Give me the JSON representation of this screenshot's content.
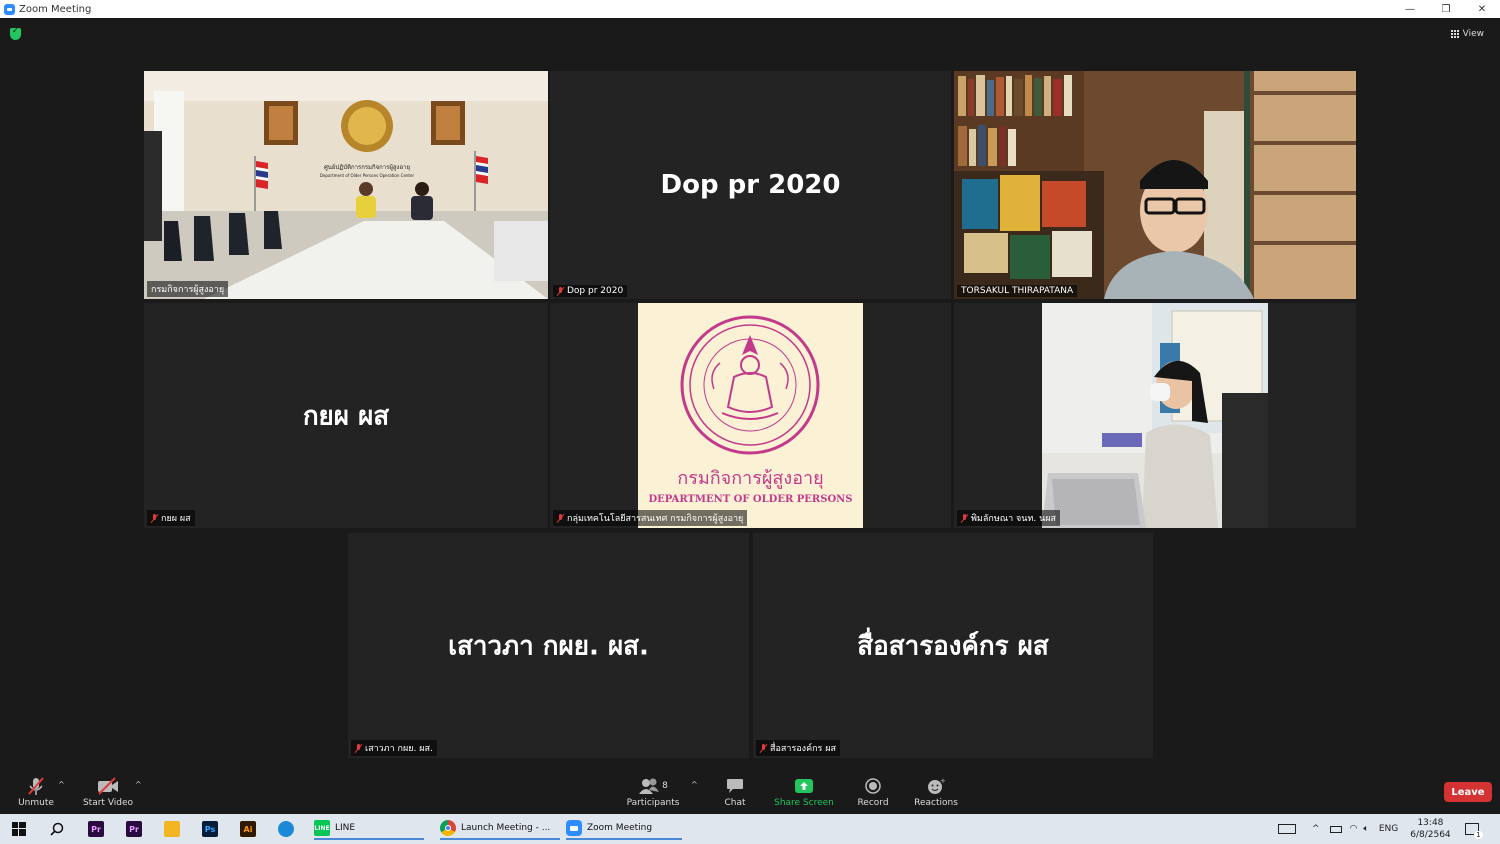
{
  "window": {
    "title": "Zoom Meeting",
    "minimize": "—",
    "restore": "❐",
    "close": "✕"
  },
  "top": {
    "view_label": "View"
  },
  "tiles": [
    {
      "id": "t1",
      "name": "กรมกิจการผู้สูงอายุ",
      "type": "video",
      "active": true
    },
    {
      "id": "t2",
      "name": "Dop pr 2020",
      "big": "Dop pr 2020",
      "type": "name"
    },
    {
      "id": "t3",
      "name": "TORSAKUL THIRAPATANA",
      "type": "video"
    },
    {
      "id": "t4",
      "name": "กยผ ผส",
      "big": "กยผ ผส",
      "type": "name"
    },
    {
      "id": "t5",
      "name": "กลุ่มเทคโนโลยีสารสนเทศ กรมกิจการผู้สูงอายุ",
      "type": "logo",
      "logo_text_th": "กรมกิจการผู้สูงอายุ",
      "logo_text_en": "DEPARTMENT OF OLDER PERSONS"
    },
    {
      "id": "t6",
      "name": "พิมลักษณา จนท. นผส",
      "type": "video"
    },
    {
      "id": "t7",
      "name": "เสาวภา กผย. ผส.",
      "big": "เสาวภา กผย. ผส.",
      "type": "name"
    },
    {
      "id": "t8",
      "name": "สื่อสารองค์กร ผส",
      "big": "สื่อสารองค์กร ผส",
      "type": "name"
    }
  ],
  "room_sign": {
    "line1": "ศูนย์ปฏิบัติการกรมกิจการผู้สูงอายุ",
    "line2": "Department of Older Persons Operation Center"
  },
  "toolbar": {
    "unmute": "Unmute",
    "start_video": "Start Video",
    "participants": "Participants",
    "participants_count": "8",
    "chat": "Chat",
    "share_screen": "Share Screen",
    "record": "Record",
    "reactions": "Reactions",
    "leave": "Leave"
  },
  "taskbar": {
    "apps": [
      {
        "name": "Pr",
        "color": "#2a0b3f",
        "fg": "#e49bff"
      },
      {
        "name": "Pr",
        "color": "#2a0b3f",
        "fg": "#e49bff"
      },
      {
        "name": "",
        "color": "#f2b624",
        "fg": "#fff"
      },
      {
        "name": "Ps",
        "color": "#061e3a",
        "fg": "#31a8ff"
      },
      {
        "name": "Ai",
        "color": "#2f1a00",
        "fg": "#ff9a00"
      }
    ],
    "line_label": "LINE",
    "chrome_label": "Launch Meeting - ...",
    "zoom_label": "Zoom Meeting",
    "lang": "ENG",
    "time": "13:48",
    "date": "6/8/2564",
    "notif_count": "1"
  },
  "colors": {
    "accent": "#2d8cff",
    "active_border": "#dbe33b",
    "leave": "#d53333",
    "share": "#23c55e",
    "mic_off": "#e03a3a"
  }
}
